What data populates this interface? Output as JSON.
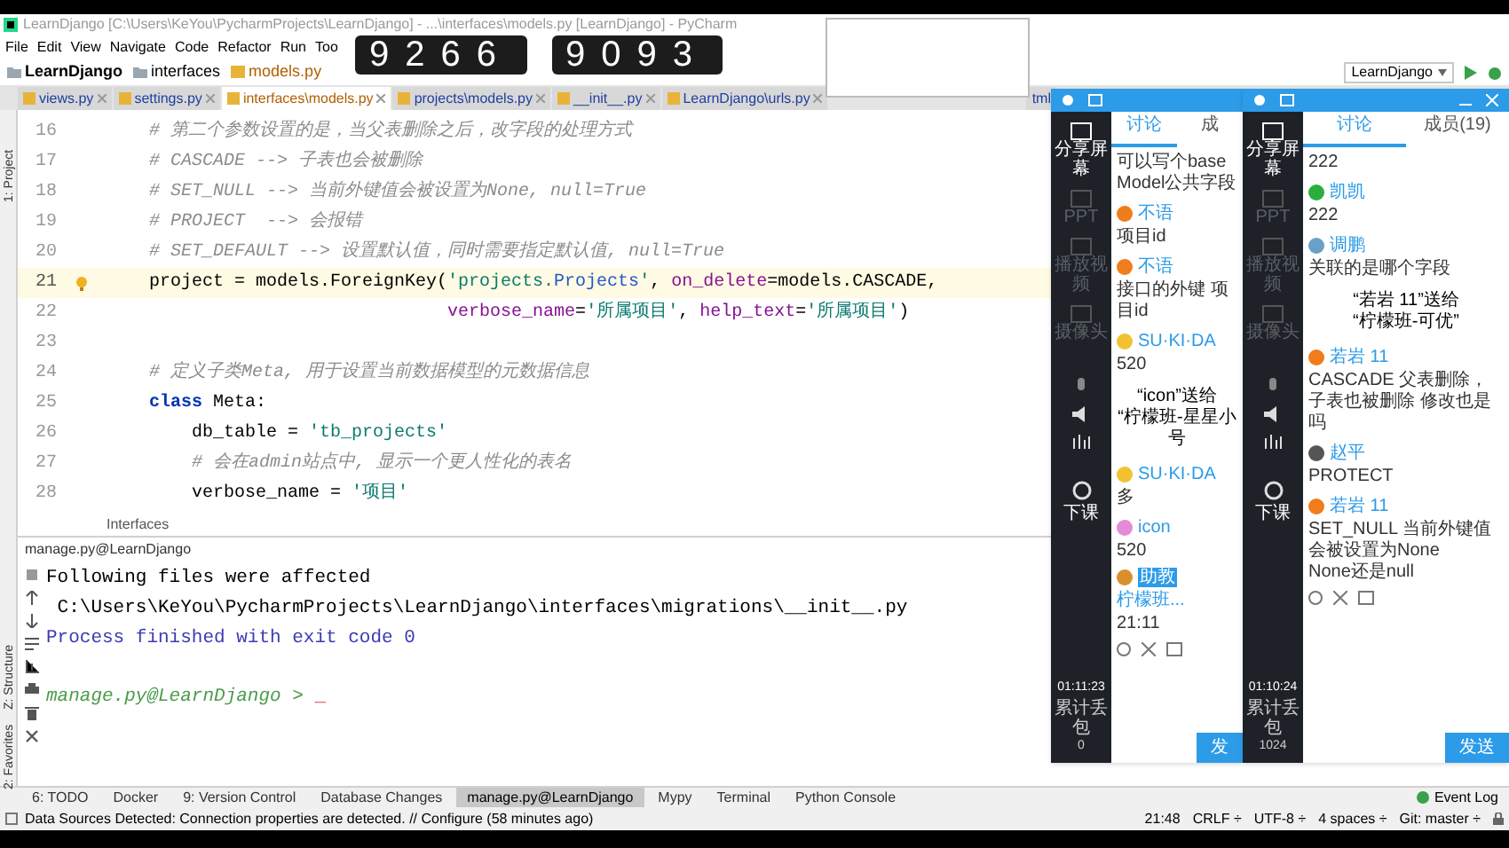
{
  "window": {
    "title": "LearnDjango [C:\\Users\\KeYou\\PycharmProjects\\LearnDjango] - ...\\interfaces\\models.py [LearnDjango] - PyCharm"
  },
  "menu": [
    "File",
    "Edit",
    "View",
    "Navigate",
    "Code",
    "Refactor",
    "Run",
    "Too"
  ],
  "overlay_counters": [
    "9266",
    "9093"
  ],
  "breadcrumb": [
    "LearnDjango",
    "interfaces",
    "models.py"
  ],
  "run_config": {
    "label": "LearnDjango"
  },
  "editor_tabs": [
    {
      "label": "views.py",
      "selected": false
    },
    {
      "label": "settings.py",
      "selected": false
    },
    {
      "label": "interfaces\\models.py",
      "selected": true
    },
    {
      "label": "projects\\models.py",
      "selected": false
    },
    {
      "label": "__init__.py",
      "selected": false
    },
    {
      "label": "LearnDjango\\urls.py",
      "selected": false
    },
    {
      "label": "tml",
      "selected": false
    }
  ],
  "side_tabs": [
    "1: Project",
    "Z: Structure",
    "2: Favorites"
  ],
  "code": [
    {
      "number": "16",
      "current": false,
      "tokens": [
        {
          "kind": "comment",
          "text": "    # 第二个参数设置的是，当父表删除之后，改字段的处理方式"
        }
      ]
    },
    {
      "number": "17",
      "current": false,
      "tokens": [
        {
          "kind": "comment",
          "text": "    # CASCADE --> 子表也会被删除"
        }
      ]
    },
    {
      "number": "18",
      "current": false,
      "tokens": [
        {
          "kind": "comment",
          "text": "    # SET_NULL --> 当前外键值会被设置为None, null=True"
        }
      ]
    },
    {
      "number": "19",
      "current": false,
      "tokens": [
        {
          "kind": "comment",
          "text": "    # PROJECT  --> 会报错"
        }
      ]
    },
    {
      "number": "20",
      "current": false,
      "tokens": [
        {
          "kind": "comment",
          "text": "    # SET_DEFAULT --> 设置默认值，同时需要指定默认值, null=True"
        }
      ]
    },
    {
      "number": "21",
      "current": true,
      "tokens": [
        {
          "kind": "plain",
          "text": "    project = models.ForeignKey("
        },
        {
          "kind": "string",
          "text": "'projects."
        },
        {
          "kind": "class",
          "text": "Projects"
        },
        {
          "kind": "string",
          "text": "'"
        },
        {
          "kind": "plain",
          "text": ", "
        },
        {
          "kind": "param",
          "text": "on_delete"
        },
        {
          "kind": "plain",
          "text": "=models.CASCADE,"
        }
      ]
    },
    {
      "number": "22",
      "current": false,
      "tokens": [
        {
          "kind": "param",
          "text": "                                verbose_name"
        },
        {
          "kind": "plain",
          "text": "="
        },
        {
          "kind": "string",
          "text": "'所属项目'"
        },
        {
          "kind": "plain",
          "text": ", "
        },
        {
          "kind": "param",
          "text": "help_text"
        },
        {
          "kind": "plain",
          "text": "="
        },
        {
          "kind": "string",
          "text": "'所属项目'"
        },
        {
          "kind": "plain",
          "text": ")"
        }
      ]
    },
    {
      "number": "23",
      "current": false
    },
    {
      "number": "24",
      "current": false,
      "tokens": [
        {
          "kind": "comment",
          "text": "    # 定义子类Meta, 用于设置当前数据模型的元数据信息"
        }
      ]
    },
    {
      "number": "25",
      "current": false,
      "tokens": [
        {
          "kind": "keyword",
          "text": "    class"
        },
        {
          "kind": "plain",
          "text": " Meta:"
        }
      ]
    },
    {
      "number": "26",
      "current": false,
      "tokens": [
        {
          "kind": "plain",
          "text": "        db_table = "
        },
        {
          "kind": "string",
          "text": "'tb_projects'"
        }
      ]
    },
    {
      "number": "27",
      "current": false,
      "tokens": [
        {
          "kind": "comment",
          "text": "        # 会在admin站点中, 显示一个更人性化的表名"
        }
      ]
    },
    {
      "number": "28",
      "current": false,
      "tokens": [
        {
          "kind": "plain",
          "text": "        verbose_name = "
        },
        {
          "kind": "string",
          "text": "'项目'"
        }
      ]
    }
  ],
  "code_breadcrumb": "Interfaces",
  "run_tab": "manage.py@LearnDjango",
  "console": [
    {
      "tokens": [
        {
          "kind": "plain",
          "text": "Following files were affected"
        }
      ]
    },
    {
      "tokens": [
        {
          "kind": "plain",
          "text": " C:\\Users\\KeYou\\PycharmProjects\\LearnDjango\\interfaces\\migrations\\__init__.py"
        }
      ]
    },
    {
      "tokens": [
        {
          "kind": "info",
          "text": "Process finished with exit code 0"
        }
      ]
    },
    {
      "tokens": [
        {
          "kind": "prompt",
          "text": "manage.py@LearnDjango > "
        },
        {
          "kind": "cursor",
          "text": "_"
        }
      ]
    }
  ],
  "tool_windows": [
    {
      "label": "6: TODO",
      "selected": false
    },
    {
      "label": "Docker",
      "selected": false
    },
    {
      "label": "9: Version Control",
      "selected": false
    },
    {
      "label": "Database Changes",
      "selected": false
    },
    {
      "label": "manage.py@LearnDjango",
      "selected": true
    },
    {
      "label": "Mypy",
      "selected": false
    },
    {
      "label": "Terminal",
      "selected": false
    },
    {
      "label": "Python Console",
      "selected": false
    }
  ],
  "event_log": "Event Log",
  "status": {
    "message": "Data Sources Detected: Connection properties are detected. // Configure (58 minutes ago)",
    "items": [
      "21:48",
      "CRLF ÷",
      "UTF-8 ÷",
      "4 spaces ÷",
      "Git: master ÷"
    ]
  },
  "chat_panels": [
    {
      "tools": [
        {
          "label": "分享屏幕",
          "disabled": false
        },
        {
          "label": "PPT",
          "disabled": true
        },
        {
          "label": "播放视频",
          "disabled": true
        },
        {
          "label": "摄像头",
          "disabled": true
        }
      ],
      "end_label": "下课",
      "timer": "01:11:23",
      "loss_label": "累计丢包",
      "loss": "0",
      "tabs": [
        {
          "label": "讨论",
          "selected": true
        },
        {
          "label": "成",
          "selected": false
        }
      ],
      "items": [
        {
          "kind": "message",
          "lines": [
            "可以写个baseModel公共字段"
          ]
        },
        {
          "kind": "message",
          "user": "不语",
          "color": "#f07c1c",
          "lines": [
            "项目id"
          ]
        },
        {
          "kind": "message",
          "user": "不语",
          "color": "#f07c1c",
          "lines": [
            "接口的外键 项目id"
          ]
        },
        {
          "kind": "message",
          "user": "SU·KI·DA",
          "color": "#f2c230",
          "lines": [
            "520"
          ]
        },
        {
          "kind": "gift",
          "lines": [
            "“icon”送给",
            "“柠檬班-星星小号"
          ]
        },
        {
          "kind": "message",
          "user": "SU·KI·DA",
          "color": "#f2c230",
          "lines": [
            "多"
          ]
        },
        {
          "kind": "message",
          "user": "icon",
          "color": "#e58ad6",
          "lines": [
            "520"
          ]
        },
        {
          "kind": "message",
          "user": "柠檬班...",
          "badge": "助教",
          "color": "#d8902a",
          "lines": [
            "21:11"
          ]
        }
      ],
      "send_label": "发"
    },
    {
      "tools": [
        {
          "label": "分享屏幕",
          "disabled": false
        },
        {
          "label": "PPT",
          "disabled": true
        },
        {
          "label": "播放视频",
          "disabled": true
        },
        {
          "label": "摄像头",
          "disabled": true
        }
      ],
      "end_label": "下课",
      "timer": "01:10:24",
      "loss_label": "累计丢包",
      "loss": "1024",
      "tabs": [
        {
          "label": "讨论",
          "selected": true
        },
        {
          "label": "成员(19)",
          "selected": false
        }
      ],
      "items": [
        {
          "kind": "message",
          "lines": [
            "222"
          ]
        },
        {
          "kind": "message",
          "user": "凯凯",
          "color": "#2aae3e",
          "lines": [
            "222"
          ]
        },
        {
          "kind": "message",
          "user": "调鹏",
          "color": "#6aa0c8",
          "lines": [
            "关联的是哪个字段"
          ]
        },
        {
          "kind": "gift",
          "lines": [
            "“若岩 11”送给",
            "“柠檬班-可优”"
          ]
        },
        {
          "kind": "message",
          "user": "若岩 11",
          "color": "#f07c1c",
          "lines": [
            "CASCADE 父表删除，子表也被删除 修改也是吗"
          ]
        },
        {
          "kind": "message",
          "user": "赵平",
          "color": "#555555",
          "lines": [
            "PROTECT"
          ]
        },
        {
          "kind": "message",
          "user": "若岩 11",
          "color": "#f07c1c",
          "lines": [
            "SET_NULL 当前外键值会被设置为None",
            "None还是null"
          ]
        }
      ],
      "send_label": "发送"
    }
  ]
}
